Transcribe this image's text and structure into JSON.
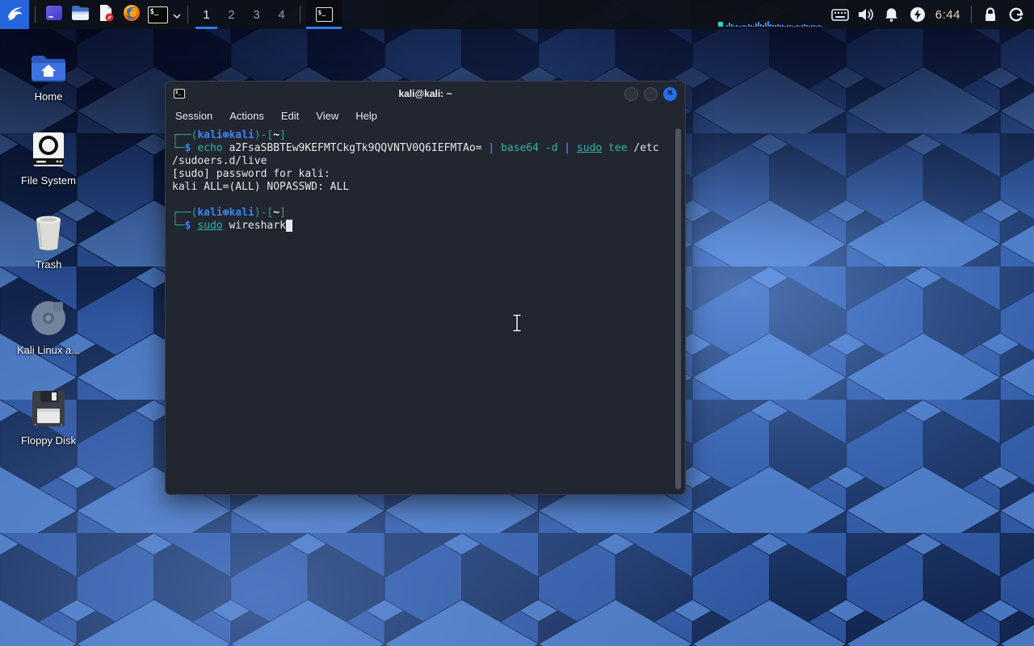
{
  "colors": {
    "accent": "#2e7de9",
    "panel_bg": "#0d1119",
    "terminal_bg": "#212630",
    "prompt_frame": "#2aa88a",
    "prompt_user_blue": "#3b82f6",
    "command_teal": "#31b3a7",
    "close_button_blue": "#2470e8",
    "clock_color": "#ead9b8"
  },
  "panel": {
    "launchers": [
      {
        "name": "whisker-menu",
        "icon": "kali-dragon-icon"
      },
      {
        "name": "app-window",
        "icon": "purple-window-icon"
      },
      {
        "name": "file-manager",
        "icon": "folder-icon"
      },
      {
        "name": "text-editor",
        "icon": "document-edit-icon"
      },
      {
        "name": "firefox",
        "icon": "firefox-icon"
      },
      {
        "name": "terminal",
        "icon": "terminal-icon"
      }
    ],
    "workspaces": [
      "1",
      "2",
      "3",
      "4"
    ],
    "active_workspace": "1",
    "taskbar_window_icon": "terminal-icon",
    "tray": [
      "cpu-graph",
      "keyboard-indicator",
      "volume",
      "notifications",
      "power-manager"
    ],
    "clock": "6:44",
    "session_icons": [
      "lock-screen",
      "log-out"
    ],
    "cpu_bars": [
      2,
      5,
      3,
      1,
      2,
      1,
      1,
      2,
      1,
      3,
      2,
      1,
      4,
      6,
      3,
      2,
      5,
      7,
      3,
      2,
      2,
      3,
      2,
      2,
      1,
      2,
      2,
      1,
      1,
      2,
      1,
      2,
      3,
      2,
      1,
      2,
      2,
      1,
      2,
      1
    ]
  },
  "desktop": {
    "icons": [
      {
        "label": "Home",
        "icon": "home-folder-icon"
      },
      {
        "label": "File System",
        "icon": "filesystem-drive-icon"
      },
      {
        "label": "Trash",
        "icon": "trash-icon"
      },
      {
        "label": "Kali Linux a...",
        "icon": "kali-docs-disc-icon"
      },
      {
        "label": "Floppy Disk",
        "icon": "floppy-disk-icon"
      }
    ]
  },
  "terminal_window": {
    "title": "kali@kali: ~",
    "window_buttons": [
      "minimize",
      "maximize",
      "close"
    ],
    "close_glyph": "✕",
    "menu": [
      "Session",
      "Actions",
      "Edit",
      "View",
      "Help"
    ],
    "lines": [
      [
        {
          "t": "┌──(",
          "c": "frame"
        },
        {
          "t": "kali㉿kali",
          "c": "user"
        },
        {
          "t": ")-[",
          "c": "frame"
        },
        {
          "t": "~",
          "c": "path"
        },
        {
          "t": "]",
          "c": "frame"
        }
      ],
      [
        {
          "t": "└─",
          "c": "frame"
        },
        {
          "t": "$",
          "c": "user"
        },
        {
          "t": " ",
          "c": "plain"
        },
        {
          "t": "echo",
          "c": "cmd"
        },
        {
          "t": " a2FsaSBBTEw9KEFMTCkgTk9QQVNTV0Q6IEFMTAo= ",
          "c": "plain"
        },
        {
          "t": "|",
          "c": "pipe"
        },
        {
          "t": " ",
          "c": "plain"
        },
        {
          "t": "base64",
          "c": "cmd"
        },
        {
          "t": " -d ",
          "c": "cmd"
        },
        {
          "t": "|",
          "c": "pipe"
        },
        {
          "t": " ",
          "c": "plain"
        },
        {
          "t": "sudo",
          "c": "cmdu"
        },
        {
          "t": " ",
          "c": "plain"
        },
        {
          "t": "tee",
          "c": "cmd"
        },
        {
          "t": " /etc",
          "c": "plain"
        }
      ],
      [
        {
          "t": "/sudoers.d/live",
          "c": "plain"
        }
      ],
      [
        {
          "t": "[sudo] password for kali:",
          "c": "plain"
        }
      ],
      [
        {
          "t": "kali ALL=(ALL) NOPASSWD: ALL",
          "c": "plain"
        }
      ],
      [],
      [
        {
          "t": "┌──(",
          "c": "frame"
        },
        {
          "t": "kali㉿kali",
          "c": "user"
        },
        {
          "t": ")-[",
          "c": "frame"
        },
        {
          "t": "~",
          "c": "path"
        },
        {
          "t": "]",
          "c": "frame"
        }
      ],
      [
        {
          "t": "└─",
          "c": "frame"
        },
        {
          "t": "$",
          "c": "user"
        },
        {
          "t": " ",
          "c": "plain"
        },
        {
          "t": "sudo",
          "c": "cmdu"
        },
        {
          "t": " ",
          "c": "plain"
        },
        {
          "t": "wireshark",
          "c": "plain"
        },
        {
          "t": " ",
          "c": "cursor"
        }
      ]
    ]
  }
}
